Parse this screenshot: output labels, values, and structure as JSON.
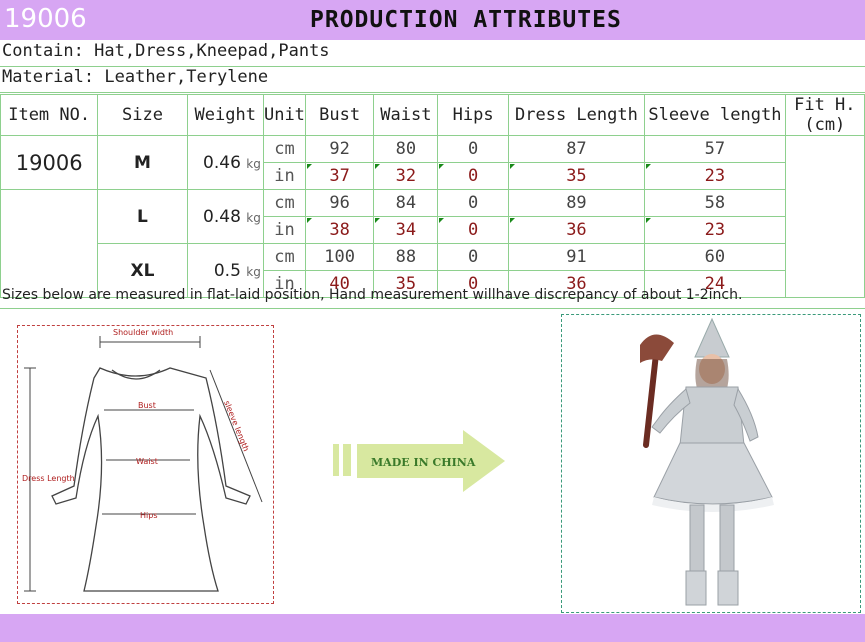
{
  "header": {
    "item_code": "19006",
    "title": "PRODUCTION ATTRIBUTES",
    "bg_color": "#d7a6f3"
  },
  "contain": {
    "label": "Contain:",
    "value": "Hat,Dress,Kneepad,Pants"
  },
  "material": {
    "label": "Material:",
    "value": "Leather,Terylene"
  },
  "table": {
    "headers": {
      "item_no": "Item NO.",
      "size": "Size",
      "weight": "Weight",
      "unit": "Unit",
      "bust": "Bust",
      "waist": "Waist",
      "hips": "Hips",
      "dress_length": "Dress Length",
      "sleeve_length": "Sleeve length",
      "fit_height": "Fit H.(cm)"
    },
    "item_no": "19006",
    "weight_unit": "kg",
    "rows": [
      {
        "size": "M",
        "weight": "0.46",
        "cm": {
          "unit": "cm",
          "bust": "92",
          "waist": "80",
          "hips": "0",
          "dress": "87",
          "sleeve": "57"
        },
        "in": {
          "unit": "in",
          "bust": "37",
          "waist": "32",
          "hips": "0",
          "dress": "35",
          "sleeve": "23"
        }
      },
      {
        "size": "L",
        "weight": "0.48",
        "cm": {
          "unit": "cm",
          "bust": "96",
          "waist": "84",
          "hips": "0",
          "dress": "89",
          "sleeve": "58"
        },
        "in": {
          "unit": "in",
          "bust": "38",
          "waist": "34",
          "hips": "0",
          "dress": "36",
          "sleeve": "23"
        }
      },
      {
        "size": "XL",
        "weight": "0.5",
        "cm": {
          "unit": "cm",
          "bust": "100",
          "waist": "88",
          "hips": "0",
          "dress": "91",
          "sleeve": "60"
        },
        "in": {
          "unit": "in",
          "bust": "40",
          "waist": "35",
          "hips": "0",
          "dress": "36",
          "sleeve": "24"
        }
      }
    ]
  },
  "note": "Sizes below are measured in flat-laid position, Hand measurement willhave discrepancy of about 1-2inch.",
  "diagram": {
    "shoulder": "Shoulder width",
    "bust": "Bust",
    "waist": "Waist",
    "hips": "Hips",
    "sleeve": "sleeve length",
    "dress_length": "Dress Length"
  },
  "arrow": {
    "text": "MADE IN CHINA",
    "color": "#d8e8a0"
  },
  "photo": {
    "icon": "costume-model-photo"
  }
}
